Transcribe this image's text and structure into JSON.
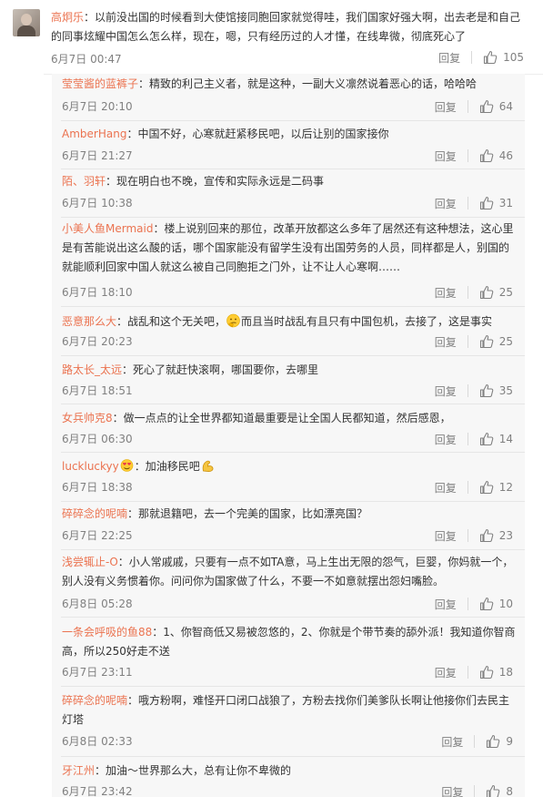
{
  "main_comment": {
    "username": "高炯乐",
    "text": "：以前没出国的时候看到大使馆接同胞回家就觉得哇，我们国家好强大啊，出去老是和自己的同事炫耀中国怎么怎么样，现在，嗯，只有经历过的人才懂，在线卑微，彻底死心了",
    "time": "6月7日 00:47",
    "reply_label": "回复",
    "likes": "105"
  },
  "replies": [
    {
      "username": "莹莹酱的蓝裤子",
      "text": "：精致的利己主义者，就是这种，一副大义凛然说着恶心的话，哈哈哈",
      "time": "6月7日 20:10",
      "reply_label": "回复",
      "likes": "64"
    },
    {
      "username": "AmberHang",
      "text": "：中国不好，心寒就赶紧移民吧，以后让别的国家接你",
      "time": "6月7日 21:27",
      "reply_label": "回复",
      "likes": "46"
    },
    {
      "username": "陌、羽轩",
      "text": "：现在明白也不晚，宣传和实际永远是二码事",
      "time": "6月7日 10:38",
      "reply_label": "回复",
      "likes": "31"
    },
    {
      "username": "小美人鱼Mermaid",
      "text": "：楼上说别回来的那位，改革开放都这么多年了居然还有这种想法，这心里是有苦能说出这么酸的话，哪个国家能没有留学生没有出国劳务的人员，同样都是人，别国的就能顺利回家中国人就这么被自己同胞拒之门外，让不让人心寒啊……",
      "time": "6月7日 18:10",
      "reply_label": "回复",
      "likes": "25"
    },
    {
      "username": "恶意那么大",
      "text_before": "：战乱和这个无关吧，",
      "emoji": "thinking-emoji",
      "text_after": "而且当时战乱有且只有中国包机，去接了，这是事实",
      "time": "6月7日 20:23",
      "reply_label": "回复",
      "likes": "25"
    },
    {
      "username": "路太长_太远",
      "text": "：死心了就赶快滚啊，哪国要你，去哪里",
      "time": "6月7日 18:51",
      "reply_label": "回复",
      "likes": "35"
    },
    {
      "username": "女兵帅克8",
      "text": "：做一点点的让全世界都知道最重要是让全国人民都知道，然后感恩，",
      "time": "6月7日 06:30",
      "reply_label": "回复",
      "likes": "14"
    },
    {
      "username": "luckluckyy",
      "badge": "heart-eyes-emoji",
      "text_before": "：加油移民吧",
      "emoji": "strong-arm-emoji",
      "text_after": "",
      "time": "6月7日 18:38",
      "reply_label": "回复",
      "likes": "12"
    },
    {
      "username": "碎碎念的呢喃",
      "text": "：那就退籍吧，去一个完美的国家，比如漂亮国？",
      "time": "6月7日 22:25",
      "reply_label": "回复",
      "likes": "23"
    },
    {
      "username": "浅尝辄止-O",
      "text": "：小人常戚戚，只要有一点不如TA意，马上生出无限的怨气，巨婴，你妈就一个，别人没有义务惯着你。问问你为国家做了什么，不要一不如意就摆出怨妇嘴脸。",
      "time": "6月8日 05:28",
      "reply_label": "回复",
      "likes": "10"
    },
    {
      "username": "一条会呼吸的鱼88",
      "text": "：1、你智商低又易被忽悠的，2、你就是个带节奏的舔外派！我知道你智商高，所以250好走不送",
      "time": "6月7日 23:11",
      "reply_label": "回复",
      "likes": "18"
    },
    {
      "username": "碎碎念的呢喃",
      "text": "：哦方粉啊，难怪开口闭口战狼了，方粉去找你们美爹队长啊让他接你们去民主灯塔",
      "time": "6月8日 02:33",
      "reply_label": "回复",
      "likes": "9"
    },
    {
      "username": "牙江州",
      "text": "：加油～世界那么大，总有让你不卑微的",
      "time": "6月7日 23:42",
      "reply_label": "回复",
      "likes": "8"
    }
  ],
  "colors": {
    "username": "#eb7350",
    "text": "#333333",
    "meta": "#808080",
    "reply_bg": "#f7f7f7"
  }
}
